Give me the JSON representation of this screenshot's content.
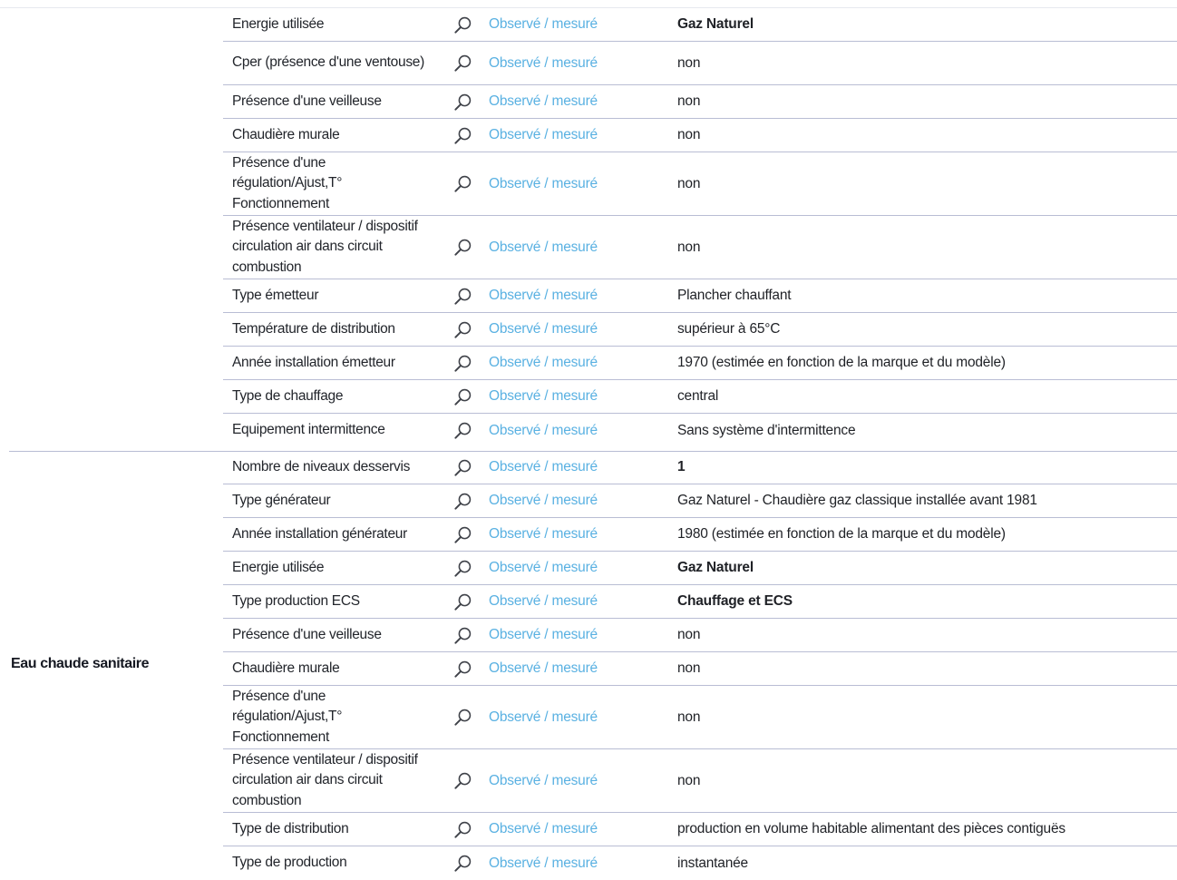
{
  "method_label": "Observé / mesuré",
  "heating": {
    "label": "",
    "rows": [
      {
        "label": "Energie utilisée",
        "value": "Gaz Naturel"
      },
      {
        "label": "Cper (présence d'une ventouse)",
        "value": "non"
      },
      {
        "label": "Présence d'une veilleuse",
        "value": "non"
      },
      {
        "label": "Chaudière murale",
        "value": "non"
      },
      {
        "label": "Présence d'une régulation/Ajust,T° Fonctionnement",
        "value": "non"
      },
      {
        "label": "Présence ventilateur / dispositif circulation air dans circuit combustion",
        "value": "non"
      },
      {
        "label": "Type émetteur",
        "value": "Plancher chauffant"
      },
      {
        "label": "Température de distribution",
        "value": "supérieur à 65°C"
      },
      {
        "label": "Année installation émetteur",
        "value": "1970 (estimée en fonction de la marque et du modèle)"
      },
      {
        "label": "Type de chauffage",
        "value": "central"
      },
      {
        "label": "Equipement intermittence",
        "value": "Sans système d'intermittence"
      }
    ]
  },
  "ecs": {
    "label": "Eau chaude sanitaire",
    "rows": [
      {
        "label": "Nombre de niveaux desservis",
        "value": "1"
      },
      {
        "label": "Type générateur",
        "value": "Gaz Naturel - Chaudière gaz classique installée avant 1981"
      },
      {
        "label": "Année installation générateur",
        "value": "1980 (estimée en fonction de la marque et du modèle)"
      },
      {
        "label": "Energie utilisée",
        "value": "Gaz Naturel"
      },
      {
        "label": "Type production ECS",
        "value": "Chauffage et ECS"
      },
      {
        "label": "Présence d'une veilleuse",
        "value": "non"
      },
      {
        "label": "Chaudière murale",
        "value": "non"
      },
      {
        "label": "Présence d'une régulation/Ajust,T° Fonctionnement",
        "value": "non"
      },
      {
        "label": "Présence ventilateur / dispositif circulation air dans circuit combustion",
        "value": "non"
      },
      {
        "label": "Type de distribution",
        "value": "production en volume habitable alimentant des pièces contiguës"
      },
      {
        "label": "Type de production",
        "value": "instantanée"
      }
    ]
  },
  "colors": {
    "method_link": "#5ab1e2",
    "row_border": "#b9bdd4",
    "text": "#1f2126"
  },
  "icons": {
    "method": "search-icon"
  }
}
